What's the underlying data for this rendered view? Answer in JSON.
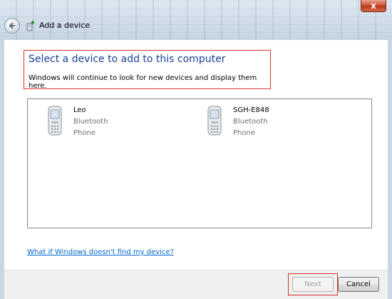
{
  "window": {
    "title": "Add a device",
    "close_label": "x"
  },
  "main": {
    "heading": "Select a device to add to this computer",
    "subtext": "Windows will continue to look for new devices and display them here.",
    "devices": [
      {
        "name": "Leo",
        "type": "Bluetooth",
        "category": "Phone",
        "icon": "phone-icon"
      },
      {
        "name": "SGH-E848",
        "type": "Bluetooth",
        "category": "Phone",
        "icon": "phone-icon"
      }
    ],
    "help_link": "What if Windows doesn't find my device?"
  },
  "footer": {
    "next_label": "Next",
    "cancel_label": "Cancel"
  },
  "colors": {
    "heading": "#1b3f94",
    "link": "#0066cc",
    "highlight_border": "#d9302b"
  }
}
